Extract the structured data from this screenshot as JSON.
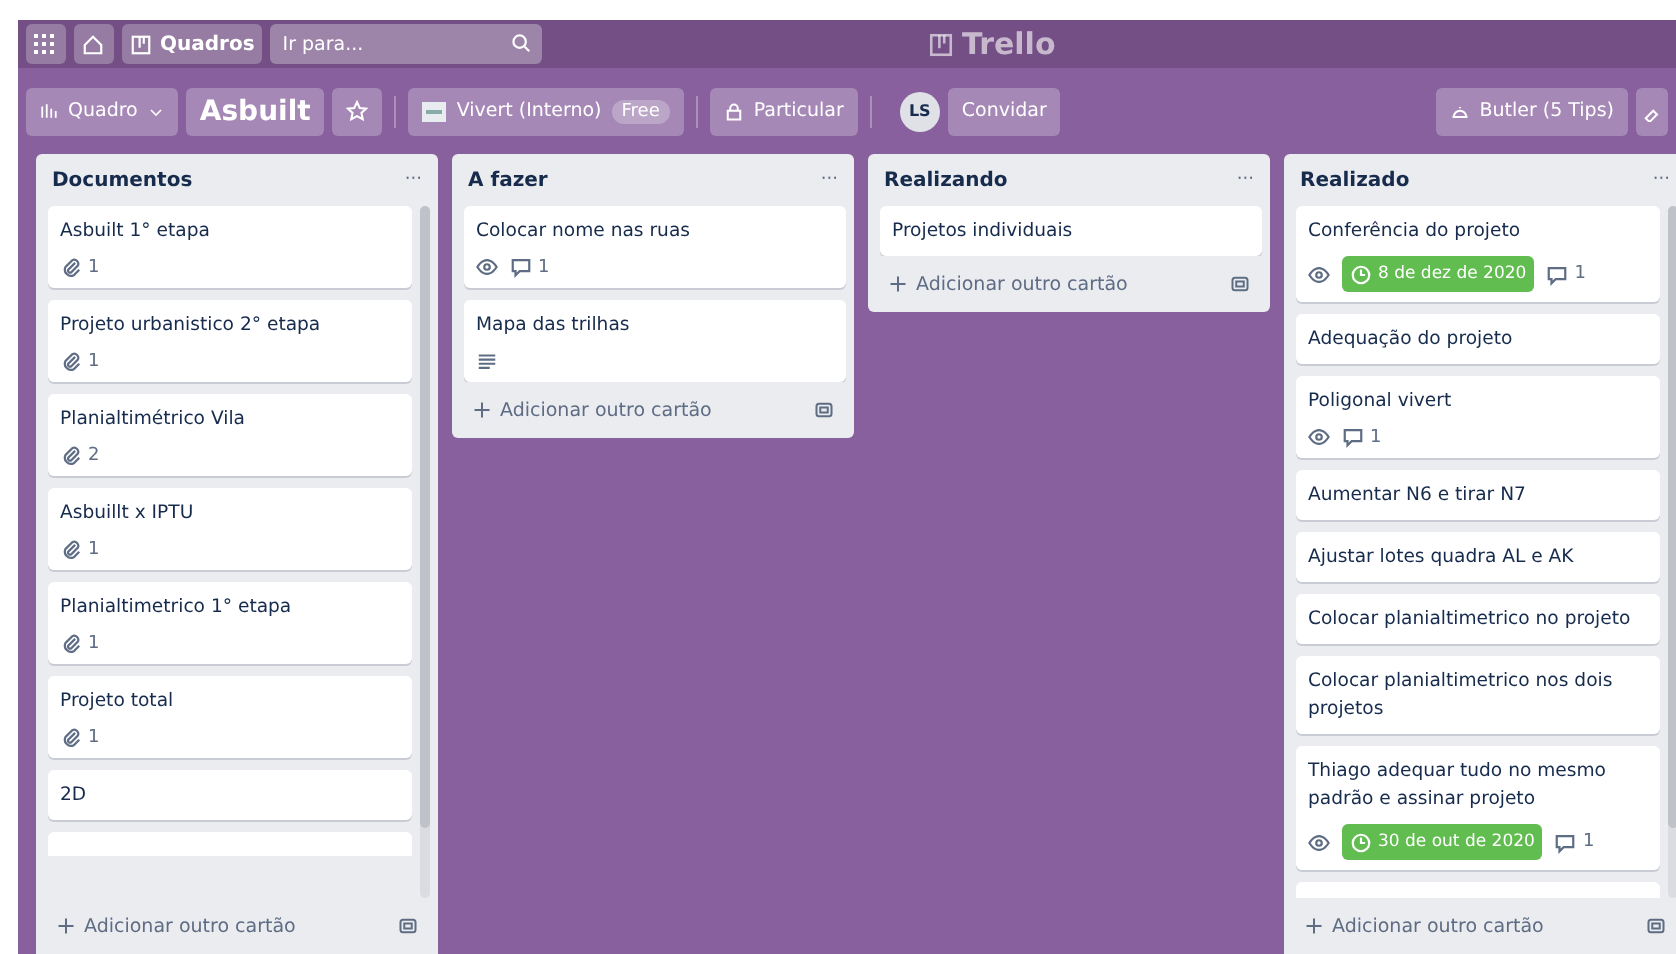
{
  "top_bar": {
    "boards_label": "Quadros",
    "search": {
      "placeholder": "Ir para..."
    },
    "logo": "Trello"
  },
  "board_header": {
    "board_type": "Quadro",
    "title": "Asbuilt",
    "starred": false,
    "workspace": {
      "name": "Vivert (Interno)",
      "plan": "Free"
    },
    "visibility": "Particular",
    "avatar": "LS",
    "invite": "Convidar",
    "butler": "Butler (5 Tips)"
  },
  "lists": [
    {
      "title": "Documentos",
      "menu": "···",
      "add_card": "Adicionar outro cartão",
      "scrollbar": true,
      "cut_card": true,
      "cards": [
        {
          "title": "Asbuilt 1° etapa",
          "badges": [
            {
              "kind": "attachments",
              "text": "1"
            }
          ]
        },
        {
          "title": "Projeto urbanistico 2° etapa",
          "badges": [
            {
              "kind": "attachments",
              "text": "1"
            }
          ]
        },
        {
          "title": "Planialtimétrico Vila",
          "badges": [
            {
              "kind": "attachments",
              "text": "2"
            }
          ]
        },
        {
          "title": "Asbuillt x IPTU",
          "badges": [
            {
              "kind": "attachments",
              "text": "1"
            }
          ]
        },
        {
          "title": "Planialtimetrico 1° etapa",
          "badges": [
            {
              "kind": "attachments",
              "text": "1"
            }
          ]
        },
        {
          "title": "Projeto total",
          "badges": [
            {
              "kind": "attachments",
              "text": "1"
            }
          ]
        },
        {
          "title": "2D"
        }
      ]
    },
    {
      "title": "A fazer",
      "menu": "···",
      "add_card": "Adicionar outro cartão",
      "scrollbar": false,
      "cut_card": false,
      "cards": [
        {
          "title": "Colocar nome nas ruas",
          "badges": [
            {
              "kind": "watch"
            },
            {
              "kind": "comments",
              "text": "1"
            }
          ]
        },
        {
          "title": "Mapa das trilhas",
          "badges": [
            {
              "kind": "description"
            }
          ]
        }
      ]
    },
    {
      "title": "Realizando",
      "menu": "···",
      "add_card": "Adicionar outro cartão",
      "scrollbar": false,
      "cut_card": false,
      "cards": [
        {
          "title": "Projetos individuais"
        }
      ]
    },
    {
      "title": "Realizado",
      "menu": "···",
      "add_card": "Adicionar outro cartão",
      "scrollbar": true,
      "cut_card": true,
      "cards": [
        {
          "title": "Conferência do projeto",
          "badges": [
            {
              "kind": "watch"
            },
            {
              "kind": "due",
              "text": "8 de dez de 2020",
              "complete": true
            },
            {
              "kind": "comments",
              "text": "1"
            }
          ]
        },
        {
          "title": "Adequação do projeto"
        },
        {
          "title": "Poligonal vivert",
          "badges": [
            {
              "kind": "watch"
            },
            {
              "kind": "comments",
              "text": "1"
            }
          ]
        },
        {
          "title": "Aumentar N6 e tirar N7"
        },
        {
          "title": "Ajustar lotes quadra AL e AK"
        },
        {
          "title": "Colocar planialtimetrico no projeto"
        },
        {
          "title": "Colocar planialtimetrico nos dois projetos"
        },
        {
          "title": "Thiago adequar tudo no mesmo padrão e assinar projeto",
          "badges": [
            {
              "kind": "watch"
            },
            {
              "kind": "due",
              "text": "30 de out de 2020",
              "complete": true
            },
            {
              "kind": "comments",
              "text": "1"
            }
          ]
        }
      ]
    }
  ]
}
